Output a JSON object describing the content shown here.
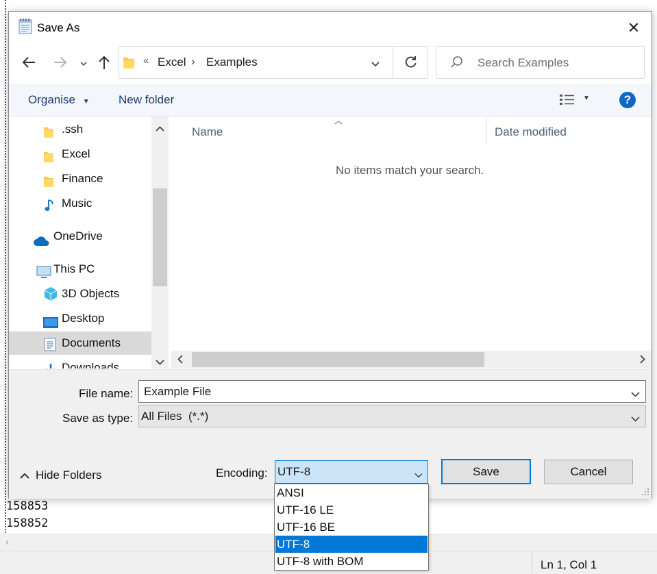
{
  "dialog": {
    "title": "Save As",
    "close_label": "✕"
  },
  "address": {
    "overflow": "«",
    "crumbs": [
      "Excel",
      "Examples"
    ],
    "separator": "›"
  },
  "search": {
    "placeholder": "Search Examples"
  },
  "toolbar": {
    "organise_label": "Organise",
    "new_folder_label": "New folder",
    "help_label": "?"
  },
  "nav": {
    "items": [
      {
        "label": ".ssh",
        "icon": "folder-icon"
      },
      {
        "label": "Excel",
        "icon": "folder-icon"
      },
      {
        "label": "Finance",
        "icon": "folder-icon"
      },
      {
        "label": "Music",
        "icon": "music-icon"
      },
      {
        "label": "OneDrive",
        "icon": "cloud-icon"
      },
      {
        "label": "This PC",
        "icon": "computer-icon"
      },
      {
        "label": "3D Objects",
        "icon": "cube-icon"
      },
      {
        "label": "Desktop",
        "icon": "desktop-icon"
      },
      {
        "label": "Documents",
        "icon": "documents-icon"
      },
      {
        "label": "Downloads",
        "icon": "download-icon"
      }
    ]
  },
  "content": {
    "columns": [
      "Name",
      "Date modified"
    ],
    "empty_message": "No items match your search."
  },
  "form": {
    "file_name_label": "File name:",
    "file_name_value": "Example File",
    "type_label": "Save as type:",
    "type_value": "All Files  (*.*)",
    "hide_folders_label": "Hide Folders",
    "encoding_label": "Encoding:",
    "encoding_value": "UTF-8",
    "save_label": "Save",
    "cancel_label": "Cancel"
  },
  "encoding_options": [
    "ANSI",
    "UTF-16 LE",
    "UTF-16 BE",
    "UTF-8",
    "UTF-8 with BOM"
  ],
  "encoding_selected_index": 3,
  "notepad": {
    "lines": [
      "158853",
      "158852"
    ],
    "status": "Ln 1, Col 1"
  },
  "colors": {
    "accent": "#0078d7",
    "link_text": "#1c3e6e",
    "selection_bg": "#cce4f7"
  }
}
